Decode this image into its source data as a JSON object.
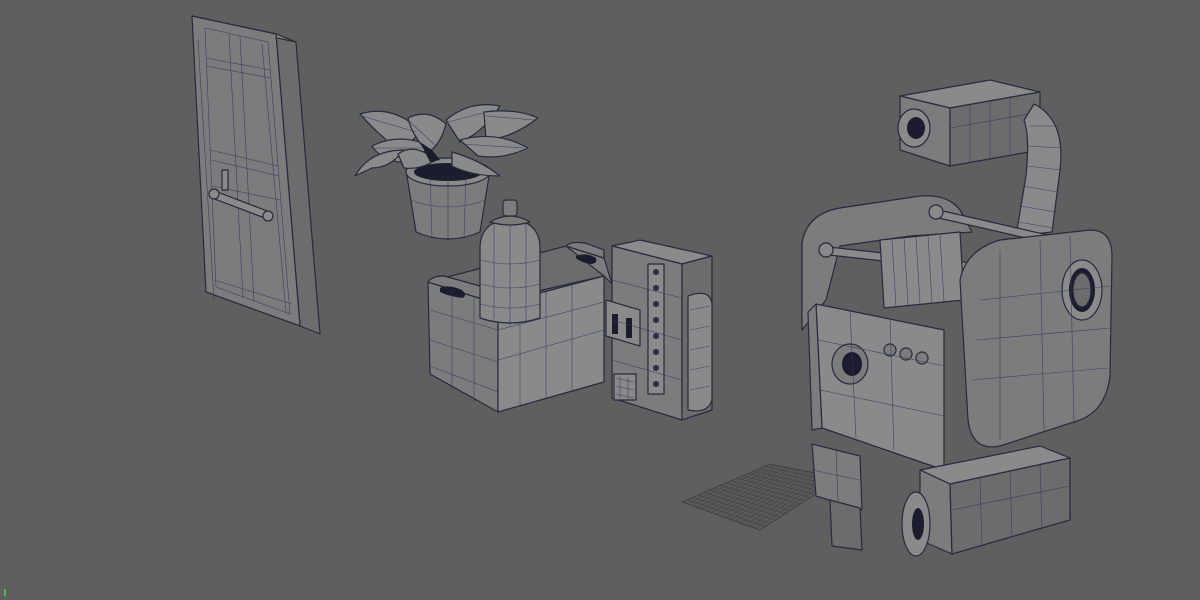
{
  "viewport": {
    "background_color": "#5f5f5f",
    "wireframe_color": "#2f3560",
    "axis_color": "#3fbf3f"
  },
  "models": [
    {
      "id": "door",
      "icon": "door-model"
    },
    {
      "id": "potted-plant",
      "icon": "plant-model"
    },
    {
      "id": "spray-can",
      "icon": "spray-can-model"
    },
    {
      "id": "wooden-crate",
      "icon": "crate-model"
    },
    {
      "id": "control-box",
      "icon": "control-box-model"
    },
    {
      "id": "robot",
      "icon": "robot-model"
    },
    {
      "id": "ground-grid",
      "icon": "grid-model"
    }
  ]
}
